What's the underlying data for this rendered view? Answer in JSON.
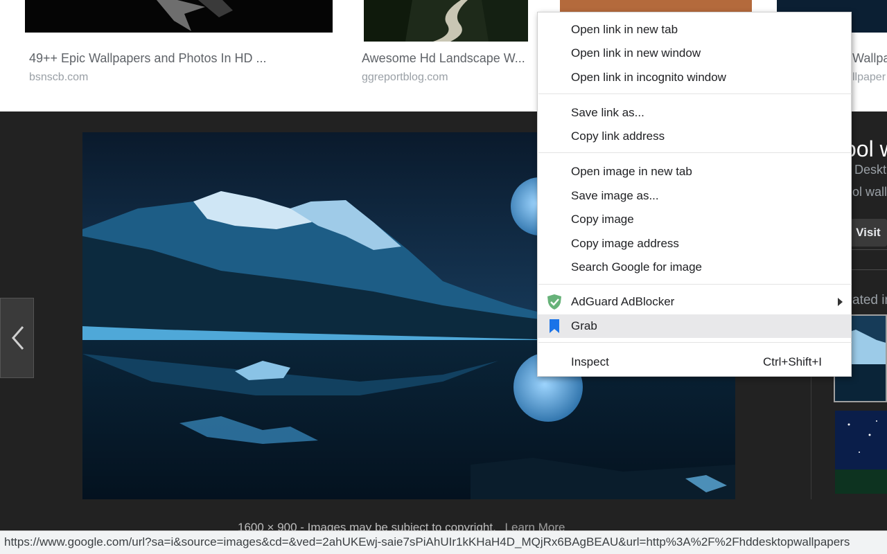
{
  "results": [
    {
      "title": "49++ Epic Wallpapers and Photos In HD ...",
      "source": "bsnscb.com"
    },
    {
      "title": "Awesome Hd Landscape W...",
      "source": "ggreportblog.com"
    },
    {
      "title": "Wallpa",
      "source": "llpaper"
    }
  ],
  "viewer": {
    "side_title": "ool w",
    "side_subtitle": "Deskt",
    "side_desc": "ol wall",
    "visit_label": "Visit",
    "related_label": "ated in",
    "image_meta": "1600 × 900 - Images may be subject to copyright.",
    "learn_more": "Learn More"
  },
  "context_menu": {
    "open_new_tab": "Open link in new tab",
    "open_new_window": "Open link in new window",
    "open_incognito": "Open link in incognito window",
    "save_link_as": "Save link as...",
    "copy_link_address": "Copy link address",
    "open_image_new_tab": "Open image in new tab",
    "save_image_as": "Save image as...",
    "copy_image": "Copy image",
    "copy_image_address": "Copy image address",
    "search_google_image": "Search Google for image",
    "adguard": "AdGuard AdBlocker",
    "grab": "Grab",
    "inspect": "Inspect",
    "inspect_shortcut": "Ctrl+Shift+I"
  },
  "status_bar": {
    "url": "https://www.google.com/url?sa=i&source=images&cd=&ved=2ahUKEwj-saie7sPiAhUIr1kKHaH4D_MQjRx6BAgBEAU&url=http%3A%2F%2Fhddesktopwallpapers"
  },
  "colors": {
    "viewer_bg": "#222222",
    "menu_highlight": "#e8e8ea",
    "adguard_green": "#67b279",
    "grab_blue": "#1a73e8"
  },
  "icons": [
    "chevron-left-icon",
    "adguard-shield-icon",
    "grab-bookmark-icon",
    "submenu-arrow-icon",
    "visit-globe-icon"
  ]
}
